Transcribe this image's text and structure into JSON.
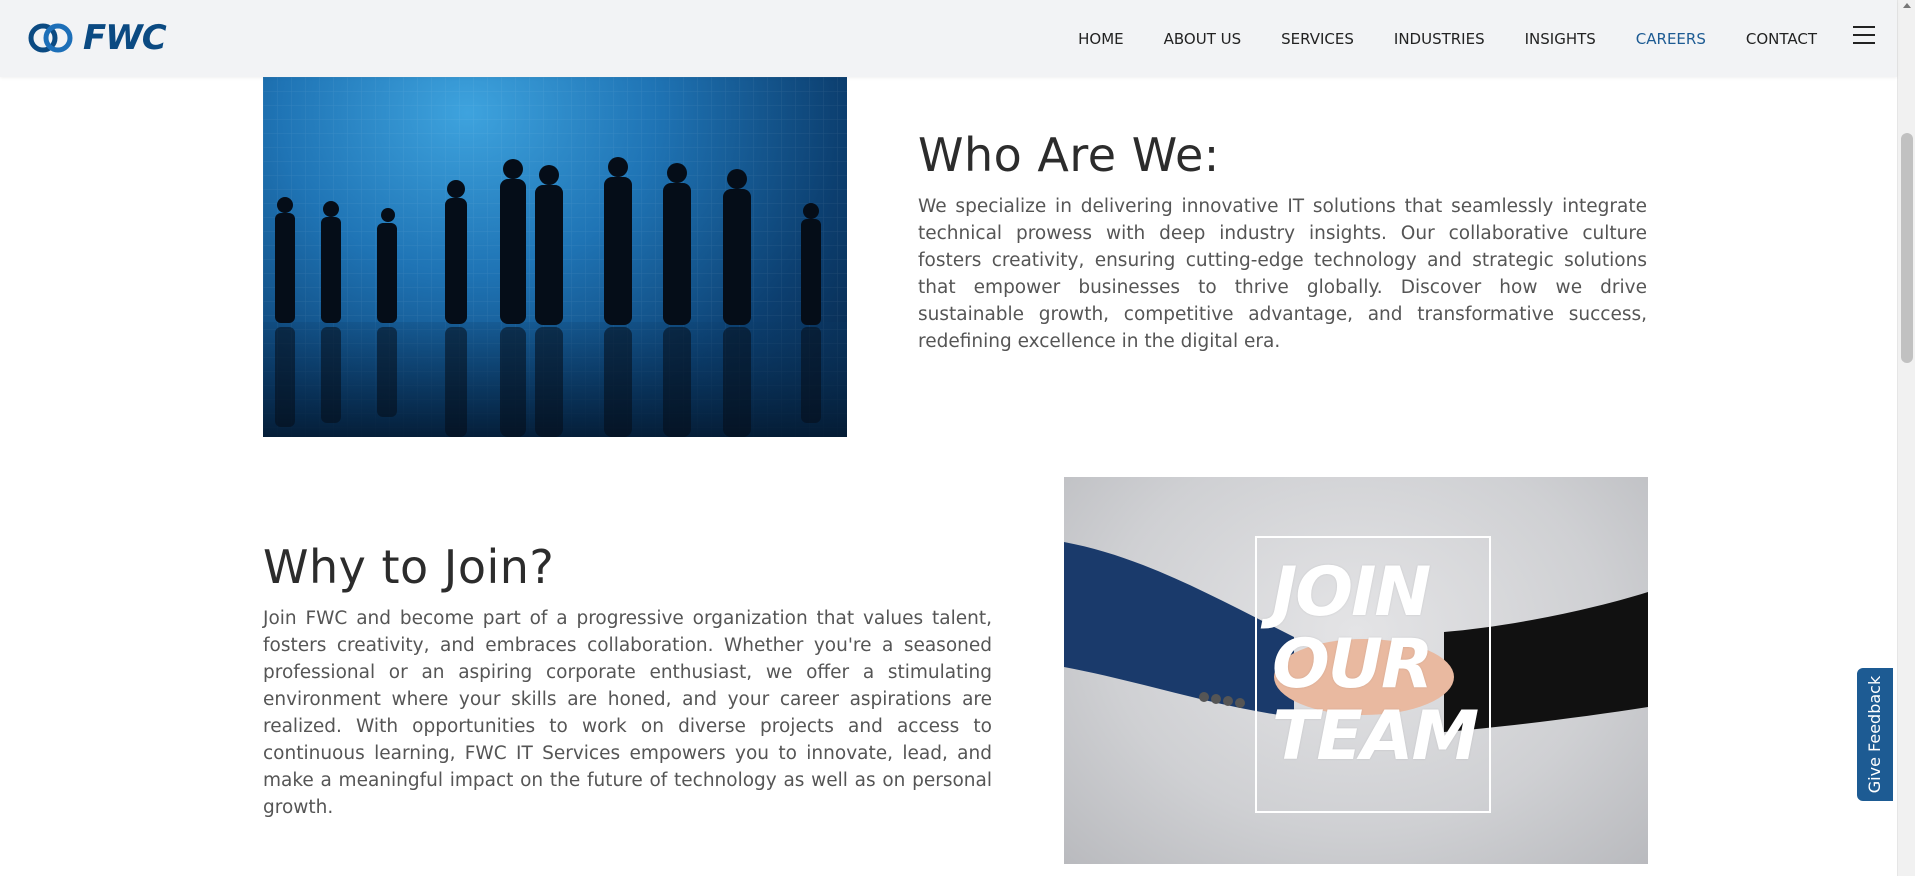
{
  "header": {
    "logo_text": "FWC",
    "nav": [
      {
        "label": "HOME",
        "active": false
      },
      {
        "label": "ABOUT US",
        "active": false
      },
      {
        "label": "SERVICES",
        "active": false
      },
      {
        "label": "INDUSTRIES",
        "active": false
      },
      {
        "label": "INSIGHTS",
        "active": false
      },
      {
        "label": "CAREERS",
        "active": true
      },
      {
        "label": "CONTACT",
        "active": false
      }
    ],
    "menu_icon": "hamburger-icon"
  },
  "who": {
    "heading": "Who Are We:",
    "body": "We specialize in delivering innovative IT solutions that seamlessly integrate technical prowess with deep industry insights. Our collaborative culture fosters creativity, ensuring cutting-edge technology and strategic solutions that empower businesses to thrive globally. Discover how we drive sustainable growth, competitive advantage, and transformative success, redefining excellence in the digital era."
  },
  "why": {
    "heading": "Why to Join?",
    "body": "Join FWC and become part of a progressive organization that values talent, fosters creativity, and embraces collaboration. Whether you're a seasoned professional or an aspiring corporate enthusiast, we offer a stimulating environment where your skills are honed, and your career aspirations are realized. With opportunities to work on diverse projects and access to continuous learning, FWC IT Services empowers you to innovate, lead, and make a meaningful impact on the future of technology as well as on personal growth."
  },
  "join_image": {
    "text_lines": [
      "JOIN",
      "OUR",
      "TEAM"
    ]
  },
  "feedback": {
    "label": "Give Feedback"
  },
  "colors": {
    "brand": "#0b4a82",
    "accent": "#1d5b93",
    "header_bg": "#f2f3f5"
  }
}
